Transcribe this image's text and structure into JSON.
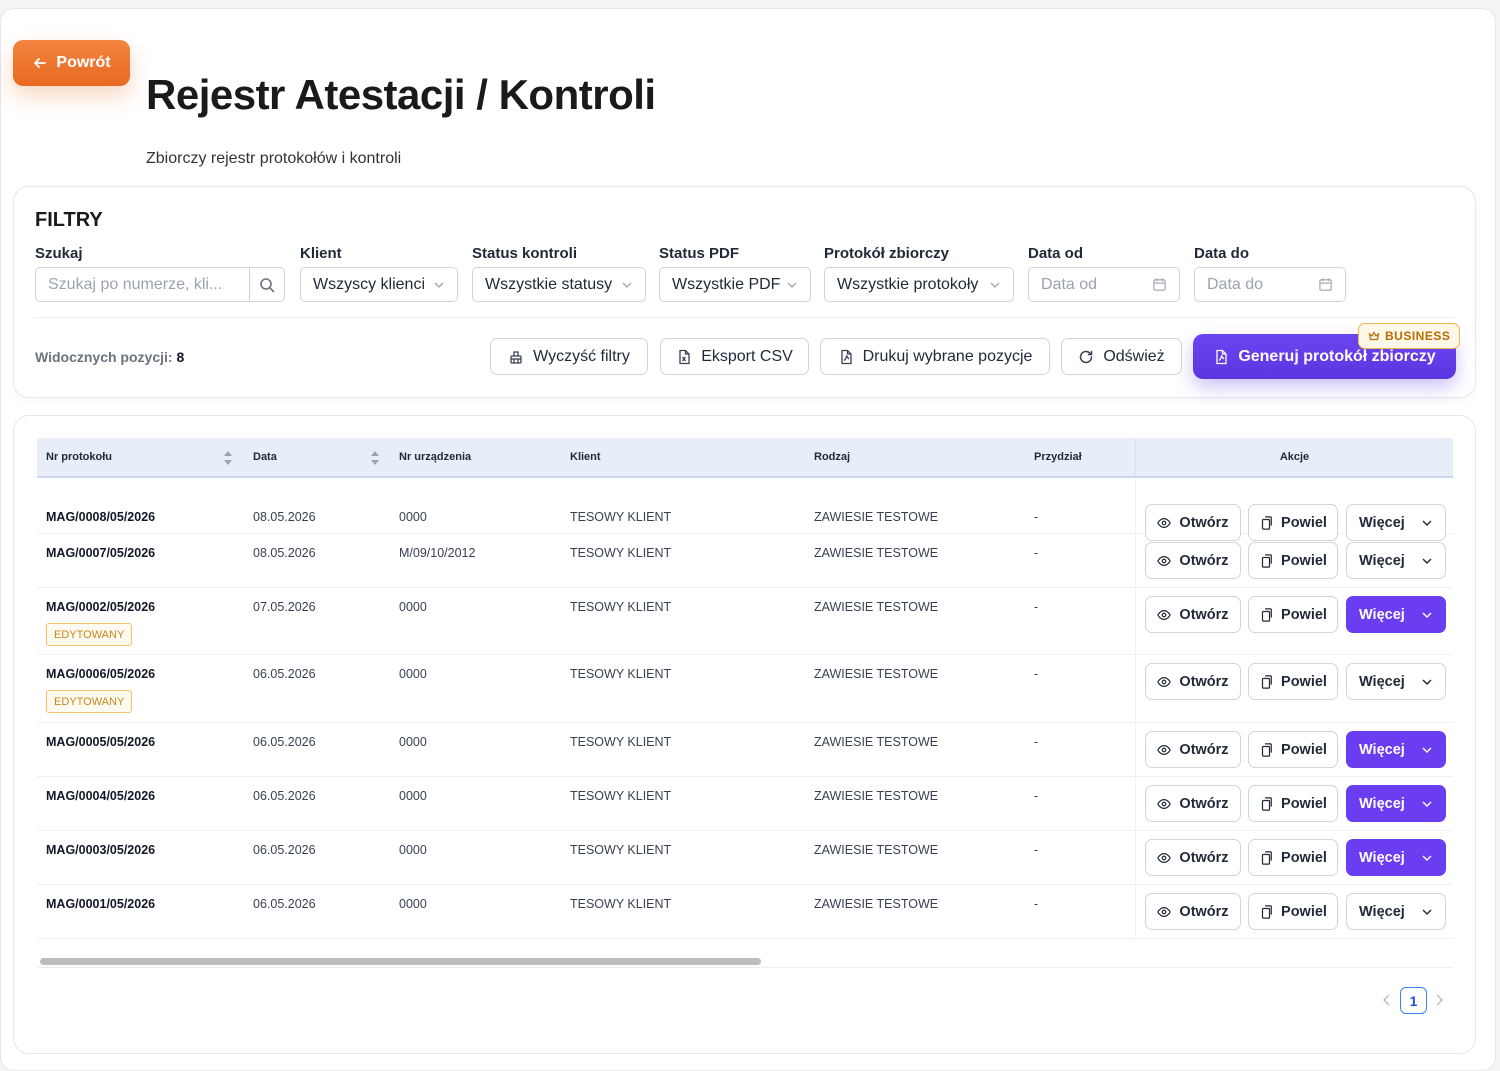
{
  "header": {
    "back_label": "Powrót",
    "title": "Rejestr Atestacji / Kontroli",
    "subtitle": "Zbiorczy rejestr protokołów i kontroli"
  },
  "filters": {
    "title": "FILTRY",
    "search": {
      "label": "Szukaj",
      "placeholder": "Szukaj po numerze, kli..."
    },
    "client": {
      "label": "Klient",
      "value": "Wszyscy klienci"
    },
    "status": {
      "label": "Status kontroli",
      "value": "Wszystkie statusy"
    },
    "pdf": {
      "label": "Status PDF",
      "value": "Wszystkie PDF"
    },
    "collective": {
      "label": "Protokół zbiorczy",
      "value": "Wszystkie protokoły"
    },
    "date_from": {
      "label": "Data od",
      "placeholder": "Data od"
    },
    "date_to": {
      "label": "Data do",
      "placeholder": "Data do"
    },
    "visible_label": "Widocznych pozycji:",
    "visible_count": "8",
    "buttons": {
      "clear": "Wyczyść filtry",
      "export": "Eksport CSV",
      "print": "Drukuj wybrane pozycje",
      "refresh": "Odśwież",
      "generate": "Generuj protokół zbiorczy",
      "business_badge": "BUSINESS"
    }
  },
  "table": {
    "columns": {
      "nr": "Nr protokołu",
      "date": "Data",
      "device": "Nr urządzenia",
      "client": "Klient",
      "type": "Rodzaj",
      "assign": "Przydział",
      "actions": "Akcje"
    },
    "open_label": "Otwórz",
    "copy_label": "Powiel",
    "more_label": "Więcej",
    "edited_label": "EDYTOWANY",
    "rows": [
      {
        "nr": "MAG/0008/05/2026",
        "date": "08.05.2026",
        "device": "0000",
        "client": "TESOWY KLIENT",
        "type": "ZAWIESIE TESTOWE",
        "assign": "-",
        "edited": false,
        "more_active": false
      },
      {
        "nr": "MAG/0007/05/2026",
        "date": "08.05.2026",
        "device": "M/09/10/2012",
        "client": "TESOWY KLIENT",
        "type": "ZAWIESIE TESTOWE",
        "assign": "-",
        "edited": false,
        "more_active": false
      },
      {
        "nr": "MAG/0002/05/2026",
        "date": "07.05.2026",
        "device": "0000",
        "client": "TESOWY KLIENT",
        "type": "ZAWIESIE TESTOWE",
        "assign": "-",
        "edited": true,
        "more_active": true
      },
      {
        "nr": "MAG/0006/05/2026",
        "date": "06.05.2026",
        "device": "0000",
        "client": "TESOWY KLIENT",
        "type": "ZAWIESIE TESTOWE",
        "assign": "-",
        "edited": true,
        "more_active": false
      },
      {
        "nr": "MAG/0005/05/2026",
        "date": "06.05.2026",
        "device": "0000",
        "client": "TESOWY KLIENT",
        "type": "ZAWIESIE TESTOWE",
        "assign": "-",
        "edited": false,
        "more_active": true
      },
      {
        "nr": "MAG/0004/05/2026",
        "date": "06.05.2026",
        "device": "0000",
        "client": "TESOWY KLIENT",
        "type": "ZAWIESIE TESTOWE",
        "assign": "-",
        "edited": false,
        "more_active": true
      },
      {
        "nr": "MAG/0003/05/2026",
        "date": "06.05.2026",
        "device": "0000",
        "client": "TESOWY KLIENT",
        "type": "ZAWIESIE TESTOWE",
        "assign": "-",
        "edited": false,
        "more_active": true
      },
      {
        "nr": "MAG/0001/05/2026",
        "date": "06.05.2026",
        "device": "0000",
        "client": "TESOWY KLIENT",
        "type": "ZAWIESIE TESTOWE",
        "assign": "-",
        "edited": false,
        "more_active": false
      }
    ]
  },
  "pagination": {
    "current_page": "1"
  },
  "colors": {
    "accent_orange": "#e96a22",
    "accent_purple": "#6a3df0",
    "header_bg": "#e8eef8"
  }
}
